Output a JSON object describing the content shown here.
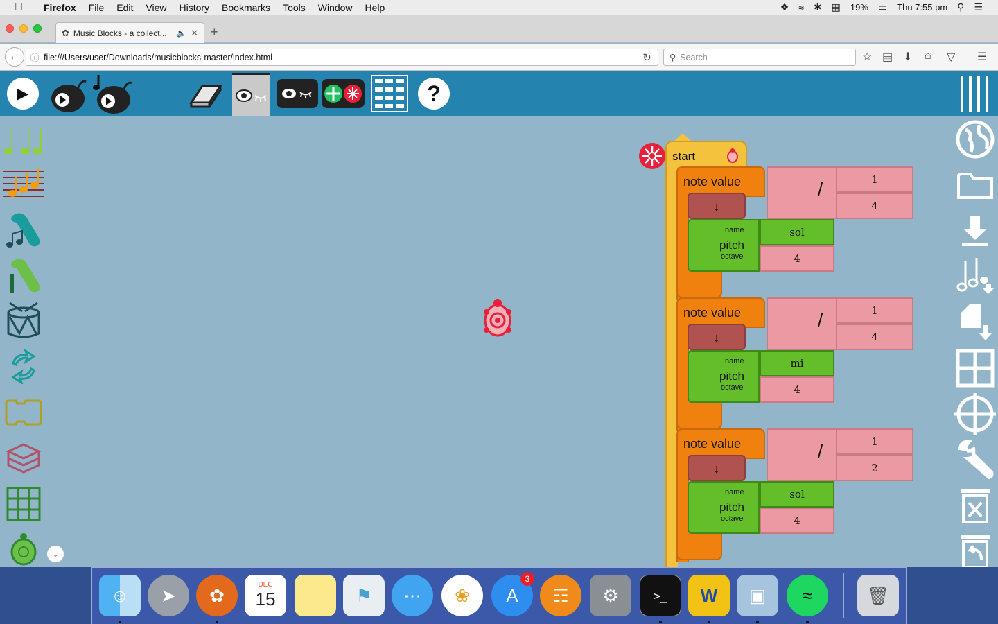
{
  "menubar": {
    "app_name": "Firefox",
    "menus": [
      "File",
      "Edit",
      "View",
      "History",
      "Bookmarks",
      "Tools",
      "Window",
      "Help"
    ],
    "battery": "19%",
    "clock": "Thu 7:55 pm"
  },
  "tab": {
    "title": "Music Blocks - a collect..."
  },
  "navbar": {
    "url": "file:///Users/user/Downloads/musicblocks-master/index.html",
    "search_placeholder": "Search"
  },
  "blocks": {
    "start_label": "start",
    "note_value_label": "note value",
    "divide_symbol": "/",
    "down_arrow": "↓",
    "pitch_label": "pitch",
    "name_label": "name",
    "octave_label": "octave",
    "notes": [
      {
        "numerator": "1",
        "denominator": "4",
        "pitch_name": "sol",
        "octave": "4"
      },
      {
        "numerator": "1",
        "denominator": "4",
        "pitch_name": "mi",
        "octave": "4"
      },
      {
        "numerator": "1",
        "denominator": "2",
        "pitch_name": "sol",
        "octave": "4"
      }
    ]
  },
  "dock": {
    "calendar_month": "DEC",
    "calendar_day": "15",
    "appstore_badge": "3"
  },
  "colors": {
    "toolbar": "#2584af",
    "canvas": "#92b5c9",
    "note_block": "#f0810f",
    "pitch_block": "#64be2a",
    "number_block": "#eb9aa3",
    "start_block": "#f5c23d"
  }
}
